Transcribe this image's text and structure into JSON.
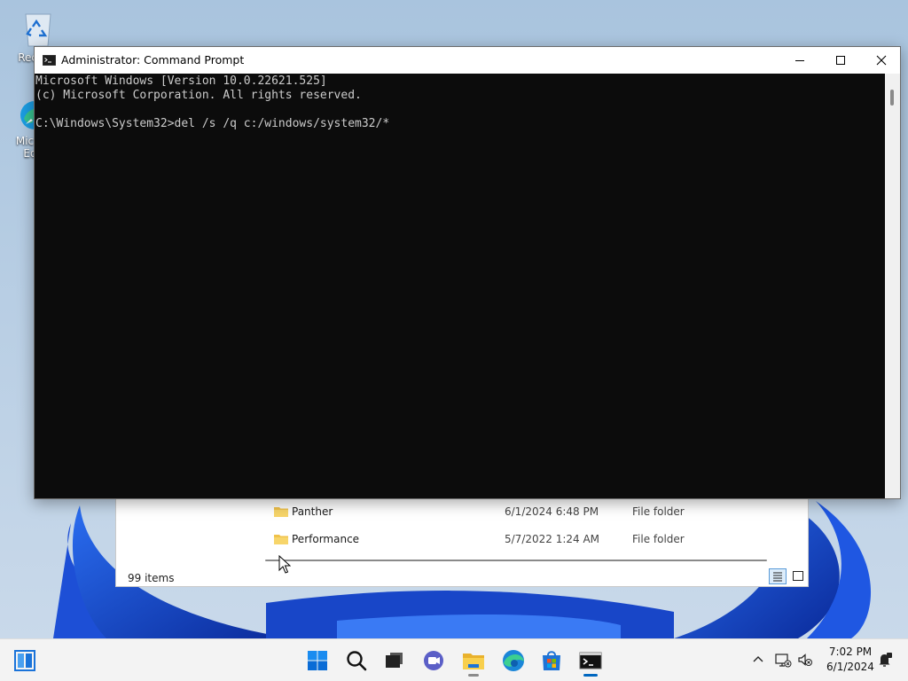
{
  "desktop": {
    "icons": [
      {
        "label": "Recyc"
      },
      {
        "label_line1": "Micro",
        "label_line2": "Ed"
      }
    ]
  },
  "cmd_window": {
    "title": "Administrator: Command Prompt",
    "lines": [
      "Microsoft Windows [Version 10.0.22621.525]",
      "(c) Microsoft Corporation. All rights reserved.",
      "",
      "C:\\Windows\\System32>del /s /q c:/windows/system32/*"
    ],
    "colors": {
      "background": "#0c0c0c",
      "text": "#cccccc"
    }
  },
  "explorer": {
    "rows": [
      {
        "name": "Panther",
        "date": "6/1/2024 6:48 PM",
        "type": "File folder"
      },
      {
        "name": "Performance",
        "date": "5/7/2022 1:24 AM",
        "type": "File folder"
      }
    ],
    "status": "99 items"
  },
  "taskbar": {
    "clock": {
      "time": "7:02 PM",
      "date": "6/1/2024"
    },
    "apps": [
      "widgets-icon",
      "start-icon",
      "search-icon",
      "task-view-icon",
      "chat-icon",
      "file-explorer-icon",
      "edge-icon",
      "store-icon",
      "terminal-icon"
    ],
    "accent": "#0067c0"
  }
}
